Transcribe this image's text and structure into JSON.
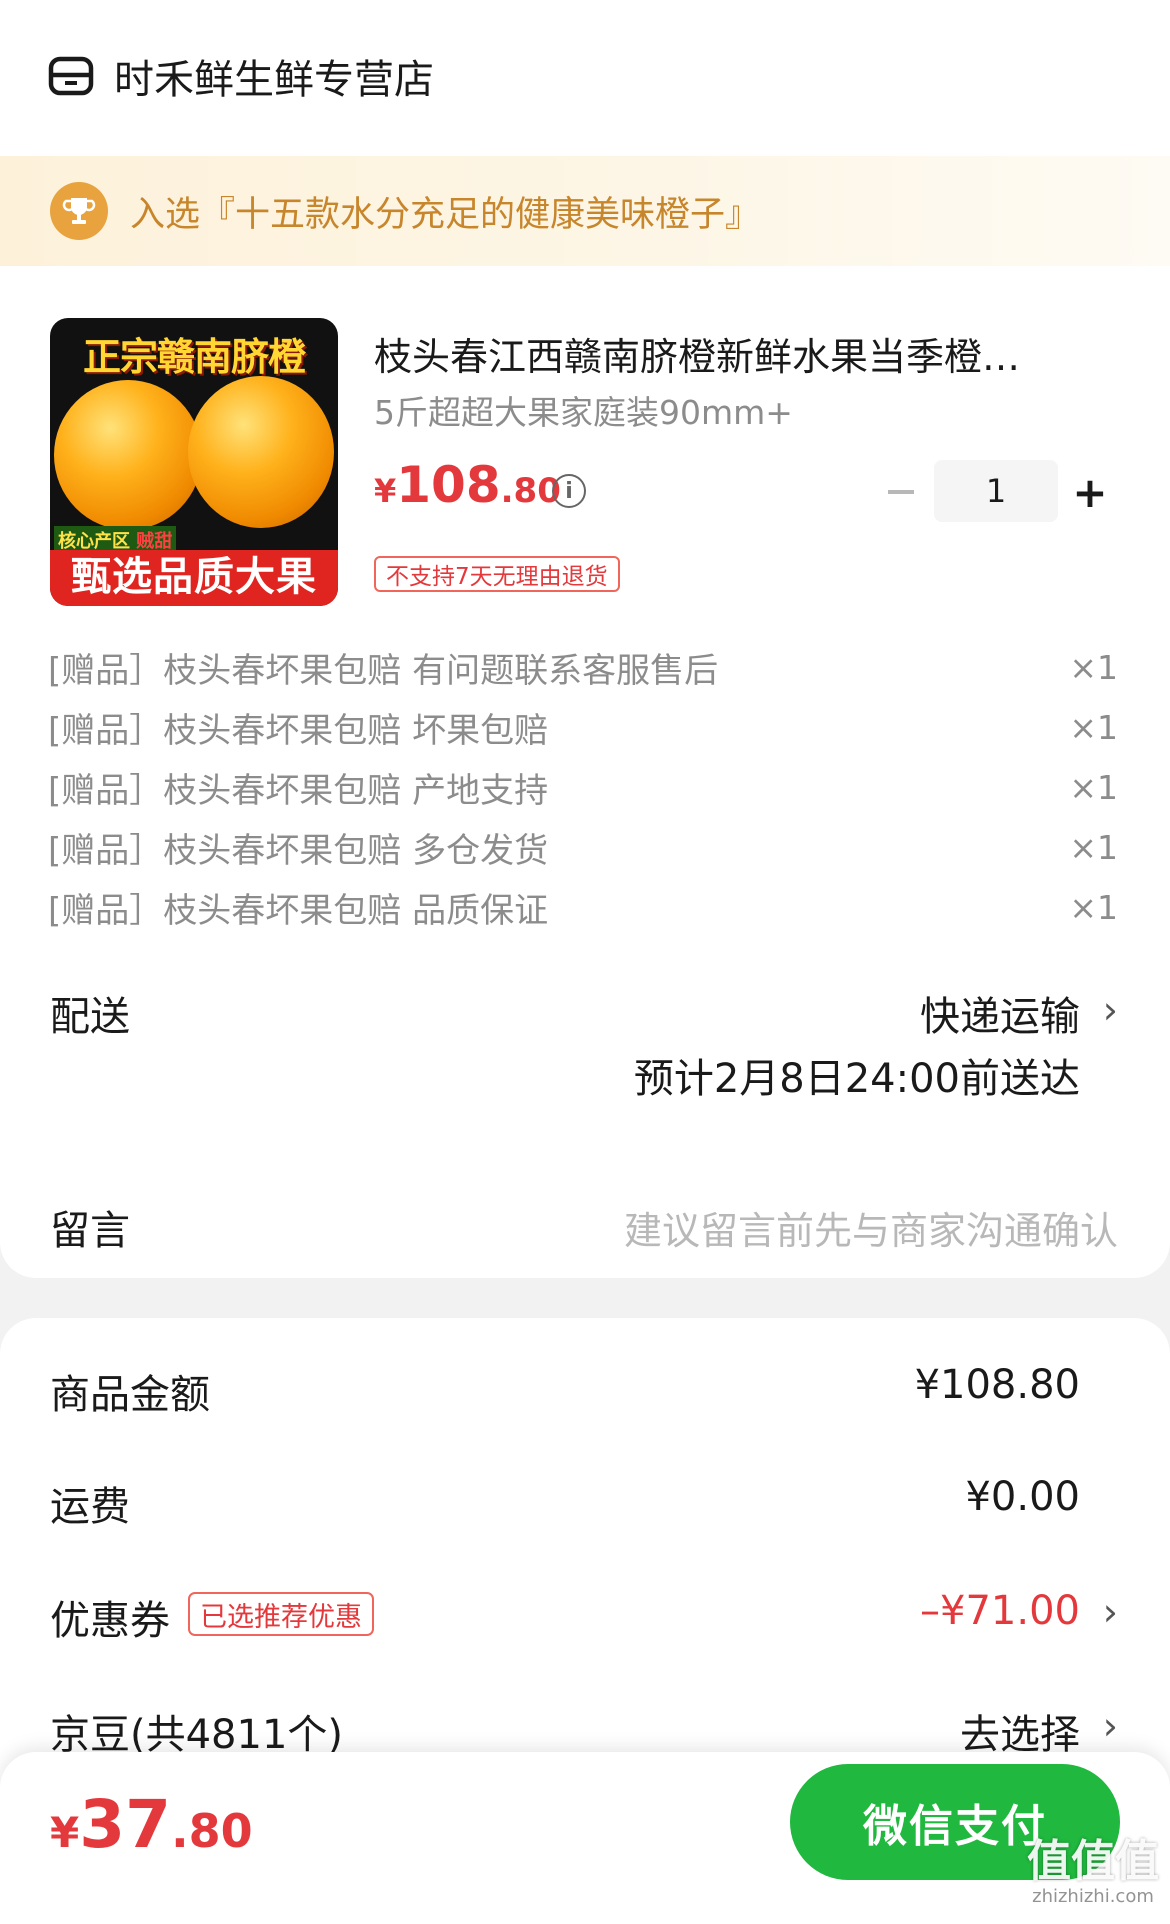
{
  "store": {
    "name": "时禾鲜生鲜专营店",
    "icon": "store-icon"
  },
  "banner": {
    "text": "入选『十五款水分充足的健康美味橙子』",
    "icon": "trophy-icon"
  },
  "product": {
    "image": {
      "title_text": "正宗赣南脐橙",
      "tag_prefix": "核心产区",
      "tag_suffix": "贼甜",
      "caption": "甄选品质大果"
    },
    "title": "枝头春江西赣南脐橙新鲜水果当季橙…",
    "spec": "5斤超超大果家庭装90mm+",
    "price": {
      "currency": "¥",
      "integer": "108",
      "decimal": ".80"
    },
    "quantity": "1",
    "plus_label": "+",
    "return_policy": "不支持7天无理由退货"
  },
  "gifts": [
    {
      "text": "[赠品］枝头春坏果包赔 有问题联系客服售后",
      "count": "×1"
    },
    {
      "text": "[赠品］枝头春坏果包赔 坏果包赔",
      "count": "×1"
    },
    {
      "text": "[赠品］枝头春坏果包赔 产地支持",
      "count": "×1"
    },
    {
      "text": "[赠品］枝头春坏果包赔 多仓发货",
      "count": "×1"
    },
    {
      "text": "[赠品］枝头春坏果包赔 品质保证",
      "count": "×1"
    }
  ],
  "delivery": {
    "label": "配送",
    "method": "快递运输",
    "eta": "预计2月8日24:00前送达"
  },
  "message": {
    "label": "留言",
    "placeholder": "建议留言前先与商家沟通确认"
  },
  "summary": {
    "goods_label": "商品金额",
    "goods_value": "¥108.80",
    "shipping_label": "运费",
    "shipping_value": "¥0.00",
    "coupon_label": "优惠券",
    "coupon_badge": "已选推荐优惠",
    "coupon_value": "–¥71.00",
    "jd_label": "京豆(共4811个)",
    "jd_action": "去选择"
  },
  "footer": {
    "total": {
      "currency": "¥",
      "integer": "37",
      "decimal": ".80"
    },
    "pay_button": "微信支付",
    "watermark_main": "值值值",
    "watermark_sub": "zhizhizhi.com"
  },
  "colors": {
    "price_red": "#e4393c",
    "pay_green": "#20b83e",
    "banner_gold": "#c7862c"
  }
}
